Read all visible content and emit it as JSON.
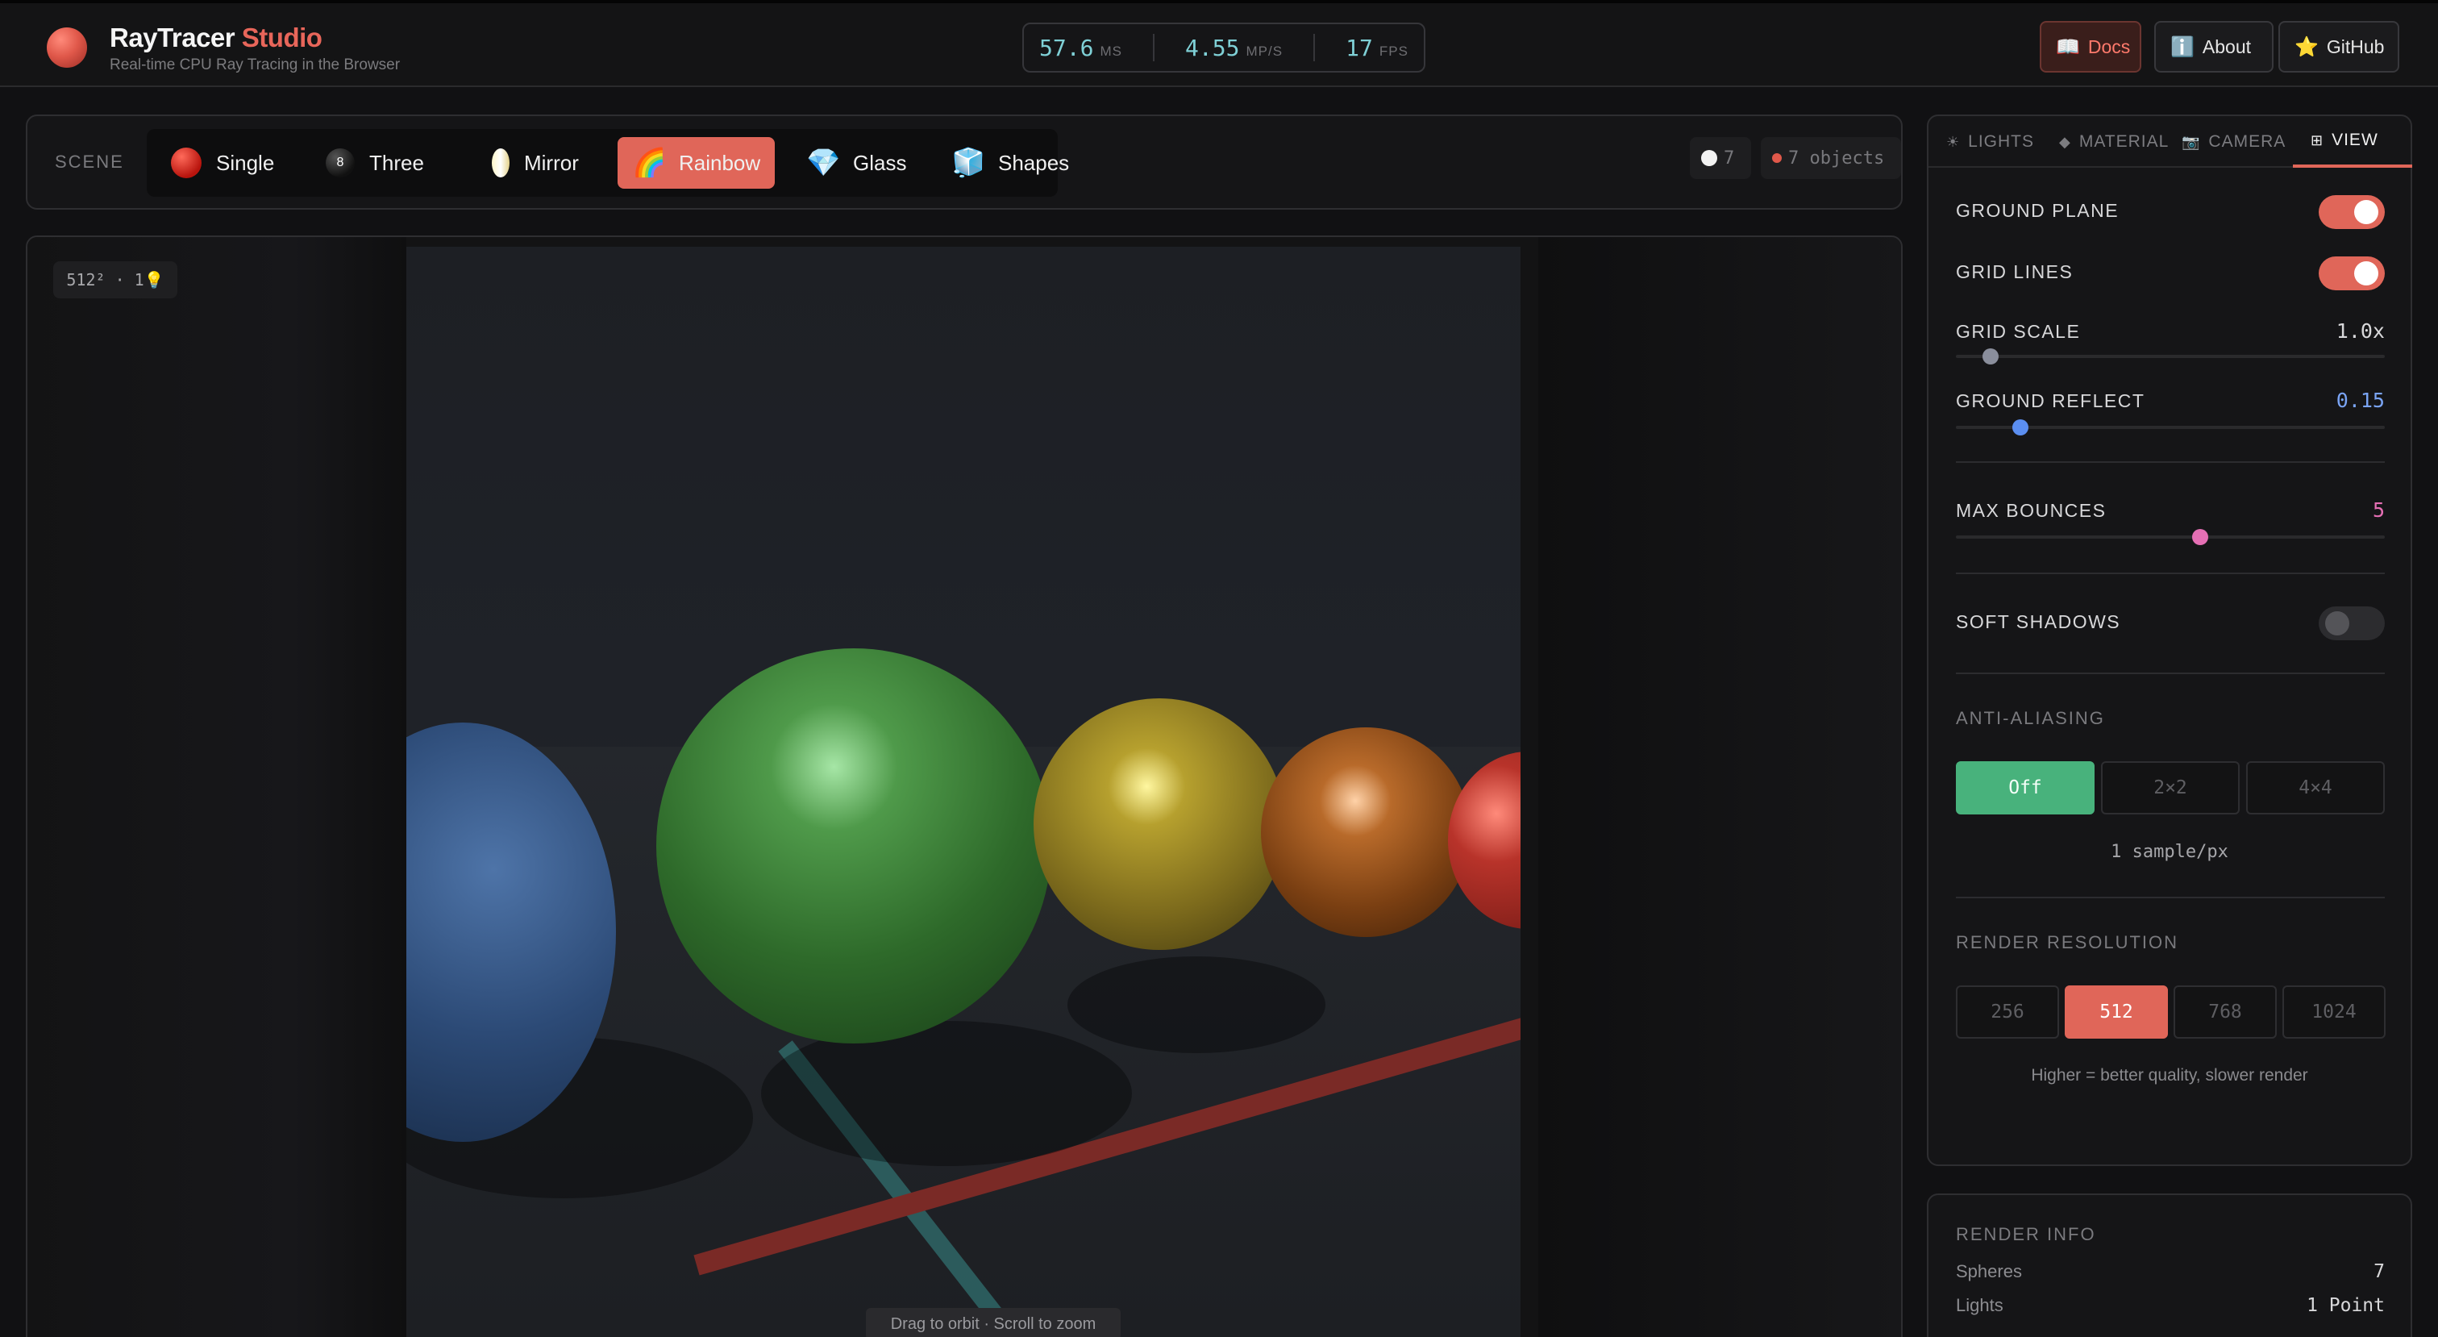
{
  "brand": {
    "title": "RayTracer",
    "title_accent": "Studio",
    "subtitle": "Real-time CPU Ray Tracing in the Browser"
  },
  "stats": [
    {
      "value": "57.6",
      "unit": "MS"
    },
    {
      "value": "4.55",
      "unit": "MP/S"
    },
    {
      "value": "17",
      "unit": "FPS"
    }
  ],
  "header_buttons": {
    "docs": {
      "icon": "book-icon",
      "label": "Docs"
    },
    "about": {
      "icon": "info-icon",
      "label": "About"
    },
    "github": {
      "icon": "star-icon",
      "label": "GitHub"
    }
  },
  "scene": {
    "label": "SCENE",
    "tabs": [
      {
        "label": "Single",
        "icon": "red-ball-icon"
      },
      {
        "label": "Three",
        "icon": "eight-ball-icon"
      },
      {
        "label": "Mirror",
        "icon": "mirror-icon"
      },
      {
        "label": "Rainbow",
        "icon": "rainbow-icon",
        "active": true
      },
      {
        "label": "Glass",
        "icon": "gem-icon"
      },
      {
        "label": "Shapes",
        "icon": "cube-icon"
      }
    ],
    "sphere_count": "7",
    "objects_label": "7 objects"
  },
  "viewport": {
    "res_badge": "512² · 1💡",
    "hint": "Drag to orbit · Scroll to zoom"
  },
  "panel": {
    "tabs": [
      {
        "label": "LIGHTS",
        "icon": "sun-icon"
      },
      {
        "label": "MATERIAL",
        "icon": "diamond-icon"
      },
      {
        "label": "CAMERA",
        "icon": "camera-icon"
      },
      {
        "label": "VIEW",
        "icon": "grid-icon",
        "active": true
      }
    ],
    "ground_plane": {
      "label": "GROUND PLANE",
      "on": true
    },
    "grid_lines": {
      "label": "GRID LINES",
      "on": true
    },
    "grid_scale": {
      "label": "GRID SCALE",
      "value": "1.0x",
      "fraction": 0.08
    },
    "ground_reflect": {
      "label": "GROUND REFLECT",
      "value": "0.15",
      "fraction": 0.15
    },
    "max_bounces": {
      "label": "MAX BOUNCES",
      "value": "5",
      "fraction": 0.57
    },
    "soft_shadows": {
      "label": "SOFT SHADOWS",
      "on": false
    },
    "anti_aliasing": {
      "label": "ANTI-ALIASING",
      "options": [
        "Off",
        "2×2",
        "4×4"
      ],
      "selected": "Off",
      "note": "1 sample/px"
    },
    "render_resolution": {
      "label": "RENDER RESOLUTION",
      "options": [
        "256",
        "512",
        "768",
        "1024"
      ],
      "selected": "512",
      "note": "Higher = better quality, slower render"
    }
  },
  "render_info": {
    "label": "RENDER INFO",
    "rows": [
      {
        "key": "Spheres",
        "value": "7"
      },
      {
        "key": "Lights",
        "value": "1 Point"
      }
    ]
  },
  "colors": {
    "accent": "#e06659",
    "stat_value": "#7fd0d6",
    "aa_active": "#48b27c",
    "reflect_thumb": "#5b8ef0",
    "bounce_thumb": "#e56fb4"
  }
}
